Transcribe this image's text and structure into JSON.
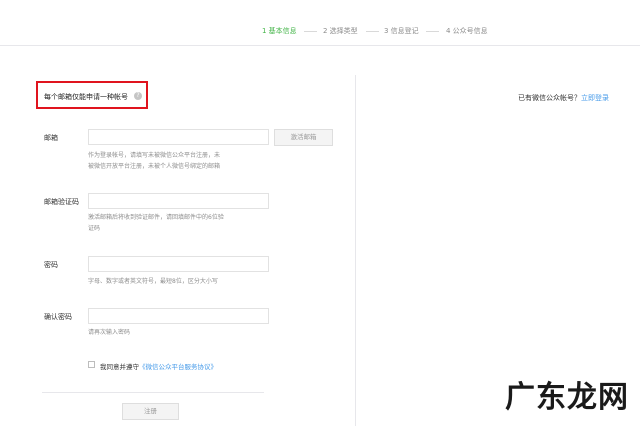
{
  "steps": [
    {
      "label": "1 基本信息",
      "active": true
    },
    {
      "label": "2 选择类型",
      "active": false
    },
    {
      "label": "3 信息登记",
      "active": false
    },
    {
      "label": "4 公众号信息",
      "active": false
    }
  ],
  "notice": {
    "text": "每个邮箱仅能申请一种帐号",
    "icon": "question-icon"
  },
  "account": {
    "prompt": "已有微信公众帐号？",
    "login_link": "立即登录"
  },
  "form": {
    "email": {
      "label": "邮箱",
      "value": "",
      "hint_line1": "作为登录帐号，请填写未被微信公众平台注册，未",
      "hint_line2": "被微信开放平台注册，未被个人微信号绑定的邮箱",
      "activate_button": "激活邮箱"
    },
    "code": {
      "label": "邮箱验证码",
      "value": "",
      "hint_line1": "激活邮箱后将收到验证邮件，请回填邮件中的6位验",
      "hint_line2": "证码"
    },
    "password": {
      "label": "密码",
      "value": "",
      "hint": "字母、数字或者英文符号，最短8位，区分大小写"
    },
    "confirm": {
      "label": "确认密码",
      "value": "",
      "hint": "请再次输入密码"
    },
    "agree": {
      "prefix": "我同意并遵守",
      "link": "《微信公众平台服务协议》",
      "checked": false
    },
    "register_button": "注册"
  },
  "watermark": {
    "text": "广东龙网"
  },
  "colors": {
    "accent": "#44b549",
    "link": "#459ae9",
    "highlight_border": "#e0141e"
  }
}
